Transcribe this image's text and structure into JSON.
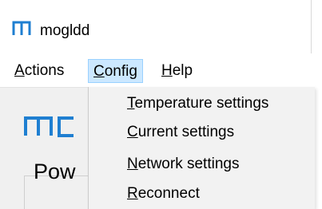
{
  "window": {
    "title": "mogldd",
    "accent": "#1f7fd1"
  },
  "menubar": {
    "items": [
      {
        "label": "Actions",
        "mnemonic": "A",
        "rest": "ctions"
      },
      {
        "label": "Config",
        "mnemonic": "C",
        "rest": "onfig",
        "active": true
      },
      {
        "label": "Help",
        "mnemonic": "H",
        "rest": "elp"
      }
    ]
  },
  "config_menu": {
    "items": [
      {
        "label": "Temperature settings",
        "mnemonic": "T",
        "rest": "emperature settings"
      },
      {
        "label": "Current settings",
        "mnemonic": "C",
        "rest": "urrent settings"
      },
      {
        "label": "Network settings",
        "mnemonic": "N",
        "rest": "etwork settings"
      },
      {
        "label": "Reconnect",
        "mnemonic": "R",
        "rest": "econnect"
      }
    ]
  },
  "main": {
    "section_label": "Pow"
  }
}
